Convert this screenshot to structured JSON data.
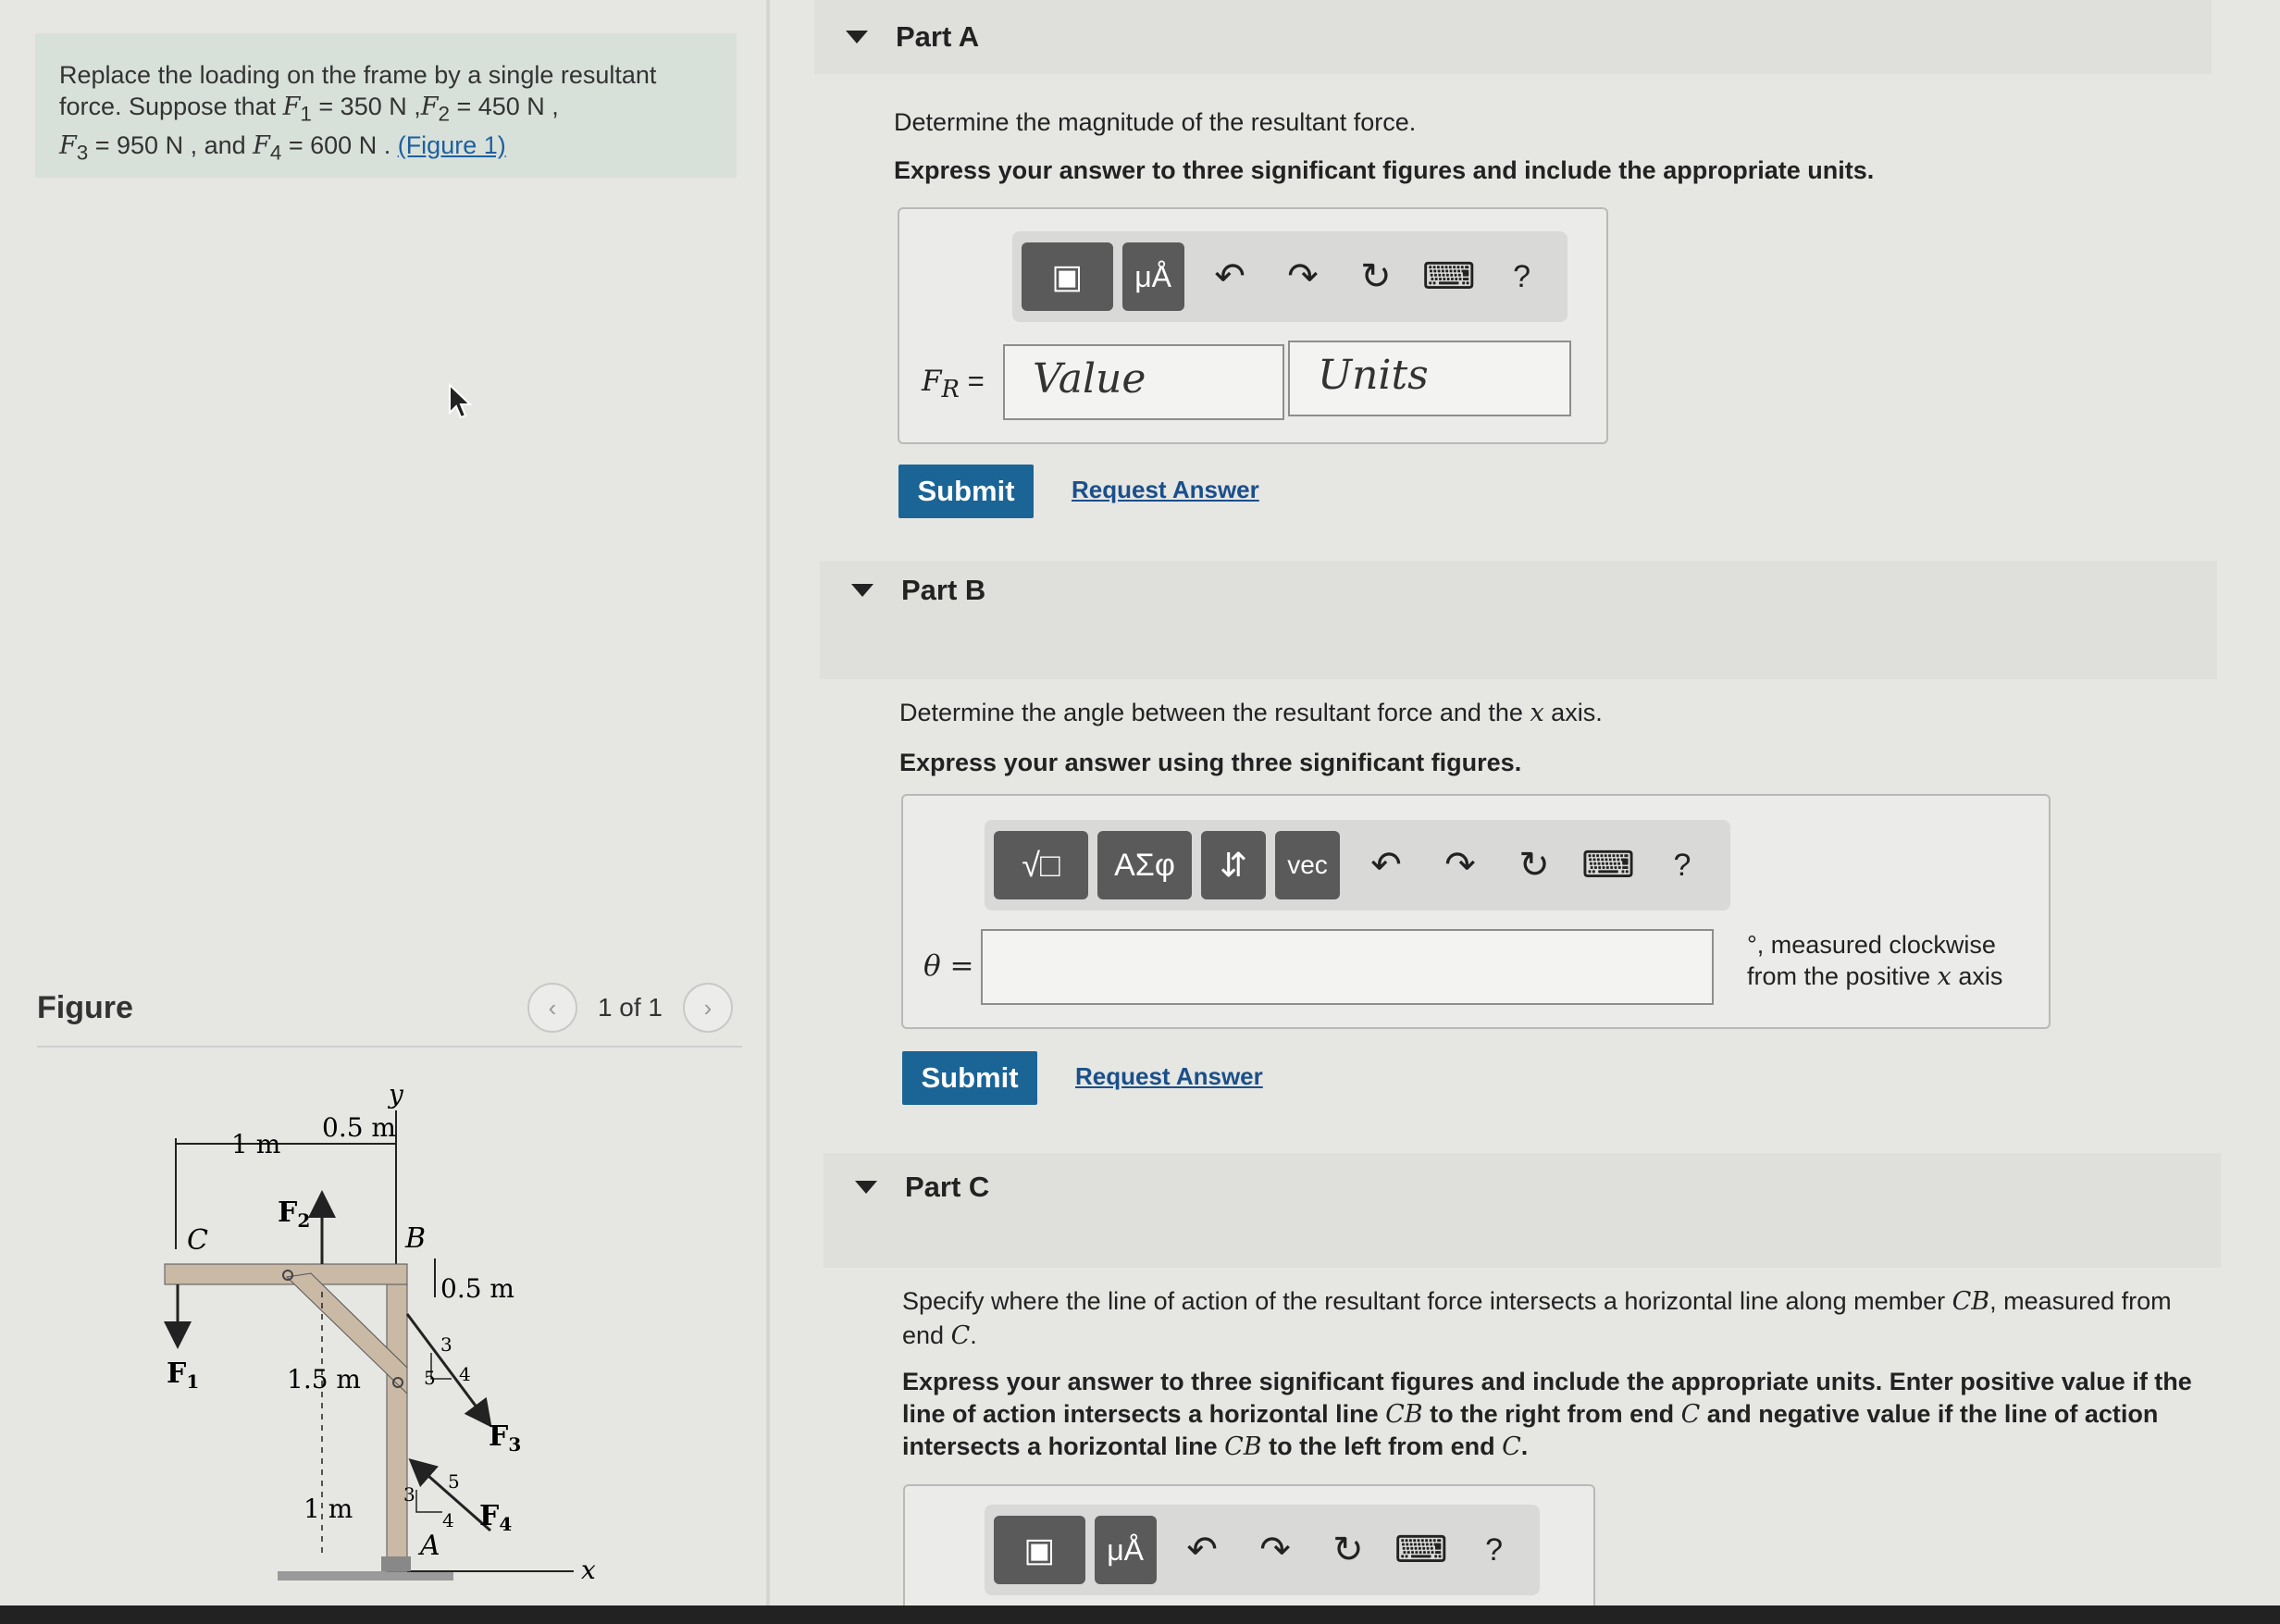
{
  "problem": {
    "line1": "Replace the loading on the frame by a single resultant",
    "line2_pre": "force. Suppose that ",
    "f1_sym": "F",
    "f1_sub": "1",
    "f1_val": " = 350  N ,",
    "f2_sym": "F",
    "f2_sub": "2",
    "f2_val": " = 450  N ,",
    "f3_sym": "F",
    "f3_sub": "3",
    "f3_val": " = 950  N , and ",
    "f4_sym": "F",
    "f4_sub": "4",
    "f4_val": " = 600  N . ",
    "figure_link": "(Figure 1)"
  },
  "figure": {
    "title": "Figure",
    "pager_text": "1 of 1",
    "prev_icon": "chevron-left-icon",
    "next_icon": "chevron-right-icon"
  },
  "diagram_labels": {
    "y": "y",
    "x": "x",
    "c": "C",
    "b": "B",
    "a": "A",
    "dim_1m_top": "1 m",
    "dim_05m_top": "0.5 m",
    "dim_05m_right": "0.5 m",
    "dim_15m": "1.5 m",
    "dim_1m_bottom": "1 m",
    "f1": "F",
    "f1_sub": "1",
    "f2": "F",
    "f2_sub": "2",
    "f3": "F",
    "f3_sub": "3",
    "f4": "F",
    "f4_sub": "4",
    "tri3_a": "3",
    "tri3_b": "4",
    "tri3_c": "5",
    "tri4_a": "3",
    "tri4_b": "4",
    "tri4_c": "5"
  },
  "partA": {
    "label": "Part A",
    "question": "Determine the magnitude of the resultant force.",
    "instruction": "Express your answer to three significant figures and include the appropriate units.",
    "toolbar": {
      "templates_icon": "templates-icon",
      "units_label": "μÅ",
      "undo_icon": "undo-icon",
      "redo_icon": "redo-icon",
      "reset_icon": "reset-icon",
      "keyboard_icon": "keyboard-icon",
      "help_label": "?"
    },
    "eq_label": "F",
    "eq_sub": "R",
    "eq_suffix": " =",
    "value_placeholder": "Value",
    "units_placeholder": "Units",
    "submit": "Submit",
    "request": "Request Answer"
  },
  "partB": {
    "label": "Part B",
    "question_pre": "Determine the angle between the resultant force and the ",
    "question_var": "x",
    "question_post": " axis.",
    "instruction": "Express your answer using three significant figures.",
    "toolbar": {
      "templates_icon": "radical-template-icon",
      "greek_label": "ΑΣφ",
      "arrows_label": "⇵",
      "vec_label": "vec",
      "undo_icon": "undo-icon",
      "redo_icon": "redo-icon",
      "reset_icon": "reset-icon",
      "keyboard_icon": "keyboard-icon",
      "help_label": "?"
    },
    "eq_label": "θ =",
    "unit_line1": "°, measured clockwise",
    "unit_line2_pre": "from the positive ",
    "unit_line2_var": "x",
    "unit_line2_post": " axis",
    "submit": "Submit",
    "request": "Request Answer"
  },
  "partC": {
    "label": "Part C",
    "q_line1_pre": "Specify where the line of action of the resultant force intersects a horizontal line along member ",
    "q_line1_var": "CB",
    "q_line1_post": ", measured from",
    "q_line2_pre": "end ",
    "q_line2_var": "C",
    "q_line2_post": ".",
    "i_line1": "Express your answer to three significant figures and include the appropriate units. Enter positive value if the",
    "i_line2_pre": "line of action intersects a horizontal line ",
    "i_line2_var": "CB",
    "i_line2_mid": " to the right from end ",
    "i_line2_var2": "C",
    "i_line2_post": " and negative value if the line of action",
    "i_line3_pre": "intersects a horizontal line ",
    "i_line3_var": "CB",
    "i_line3_mid": " to the left from end ",
    "i_line3_var2": "C",
    "i_line3_post": ".",
    "toolbar": {
      "templates_icon": "templates-icon",
      "units_label": "μÅ",
      "undo_icon": "undo-icon",
      "redo_icon": "redo-icon",
      "reset_icon": "reset-icon",
      "keyboard_icon": "keyboard-icon",
      "help_label": "?"
    }
  }
}
